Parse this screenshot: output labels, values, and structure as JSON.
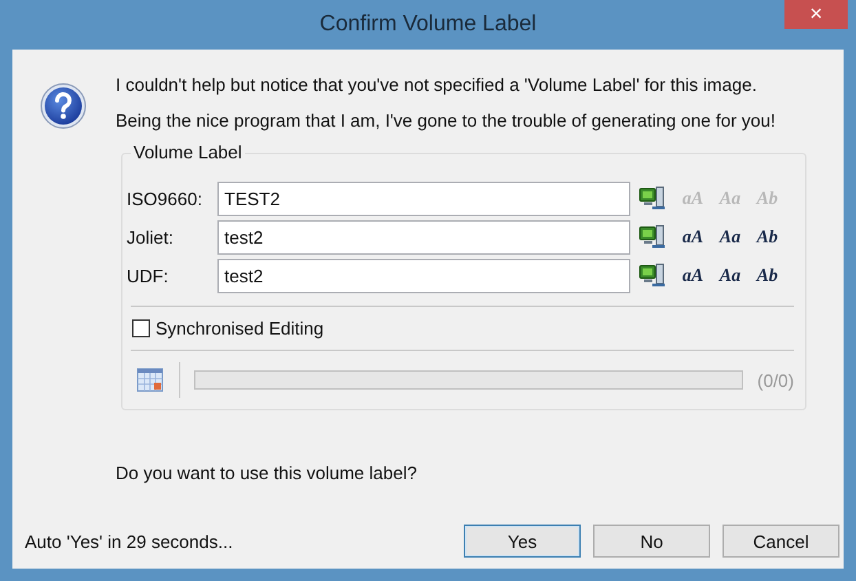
{
  "window": {
    "title": "Confirm Volume Label",
    "close": "×"
  },
  "message": [
    "I couldn't help but notice that you've not specified a 'Volume Label' for this image.",
    "Being the nice program that I am, I've gone to the trouble of generating one for you!"
  ],
  "group": {
    "title": "Volume Label",
    "rows": [
      {
        "label": "ISO9660:",
        "value": "TEST2",
        "case_buttons": [
          {
            "label": "aA",
            "disabled": true
          },
          {
            "label": "Aa",
            "disabled": true
          },
          {
            "label": "Ab",
            "disabled": true
          }
        ]
      },
      {
        "label": "Joliet:",
        "value": "test2",
        "case_buttons": [
          {
            "label": "aA",
            "disabled": false
          },
          {
            "label": "Aa",
            "disabled": false
          },
          {
            "label": "Ab",
            "disabled": false
          }
        ]
      },
      {
        "label": "UDF:",
        "value": "test2",
        "case_buttons": [
          {
            "label": "aA",
            "disabled": false
          },
          {
            "label": "Aa",
            "disabled": false
          },
          {
            "label": "Ab",
            "disabled": false
          }
        ]
      }
    ],
    "sync": {
      "label": "Synchronised Editing",
      "checked": false
    },
    "progress": {
      "level": 0,
      "count": "(0/0)"
    }
  },
  "question": "Do you want to use this volume label?",
  "countdown": "Auto 'Yes' in 29 seconds...",
  "buttons": [
    {
      "label": "Yes",
      "default": true
    },
    {
      "label": "No",
      "default": false
    },
    {
      "label": "Cancel",
      "default": false
    }
  ]
}
